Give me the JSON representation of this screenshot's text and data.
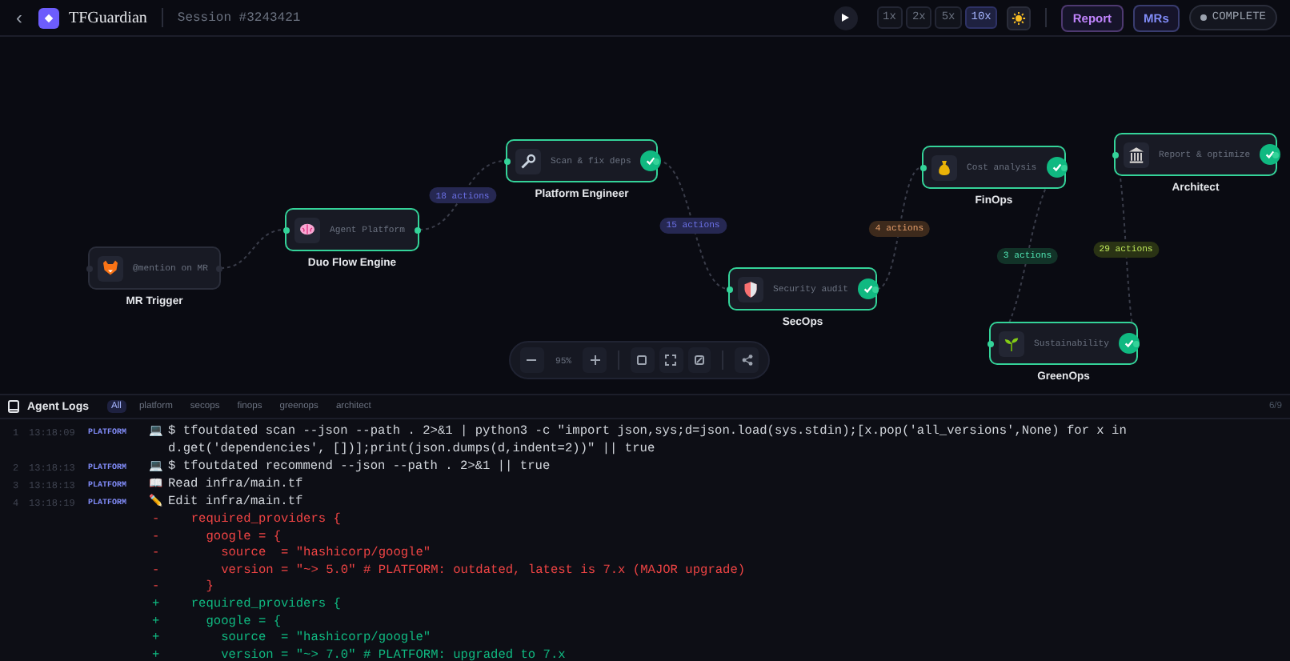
{
  "topbar": {
    "back": "‹",
    "app_name": "TFGuardian",
    "session": "Session #3243421",
    "speeds": [
      {
        "label": "1x",
        "selected": false
      },
      {
        "label": "2x",
        "selected": false
      },
      {
        "label": "5x",
        "selected": false
      },
      {
        "label": "10x",
        "selected": true
      }
    ],
    "buttons": [
      {
        "label": "Report",
        "color": "#c084fc"
      },
      {
        "label": "MRs",
        "color": "#818cf8"
      }
    ],
    "status": "COMPLETE"
  },
  "flow": {
    "nodes": [
      {
        "label": "@mention on MR",
        "name": "MR Trigger",
        "active": false,
        "completed": false
      },
      {
        "label": "Agent Platform",
        "name": "Duo Flow Engine",
        "active": true,
        "completed": false
      },
      {
        "label": "Scan & fix deps",
        "name": "Platform Engineer",
        "active": true,
        "completed": true
      },
      {
        "label": "Security audit",
        "name": "SecOps",
        "active": true,
        "completed": true
      },
      {
        "label": "Cost analysis",
        "name": "FinOps",
        "active": true,
        "completed": true
      },
      {
        "label": "Report & optimize",
        "name": "Architect",
        "active": true,
        "completed": true
      },
      {
        "label": "Sustainability",
        "name": "GreenOps",
        "active": true,
        "completed": true
      }
    ],
    "edge_labels": [
      {
        "label": "18 actions",
        "color": "#262852"
      },
      {
        "label": "15 actions",
        "color": "#262852"
      },
      {
        "label": "4 actions",
        "color": "#3d2a1c"
      },
      {
        "label": "3 actions",
        "color": "#123328"
      },
      {
        "label": "29 actions",
        "color": "#2a3314"
      }
    ],
    "zoom": "95%"
  },
  "logs": {
    "title": "Agent Logs",
    "filters": [
      {
        "label": "All",
        "selected": true
      },
      {
        "label": "platform",
        "selected": false
      },
      {
        "label": "secops",
        "selected": false
      },
      {
        "label": "finops",
        "selected": false
      },
      {
        "label": "greenops",
        "selected": false
      },
      {
        "label": "architect",
        "selected": false
      }
    ],
    "count": "6/9",
    "entries": [
      {
        "number": "1",
        "time": "13:18:09",
        "agent": "PLATFORM",
        "icon": "💻",
        "text": "$ tfoutdated scan --json --path . 2>&1 | python3 -c \"import json,sys;d=json.load(sys.stdin);[x.pop('all_versions',None) for x in d.get('dependencies', [])];print(json.dumps(d,indent=2))\" || true"
      },
      {
        "number": "2",
        "time": "13:18:13",
        "agent": "PLATFORM",
        "icon": "💻",
        "text": "$ tfoutdated recommend --json --path . 2>&1 || true"
      },
      {
        "number": "3",
        "time": "13:18:13",
        "agent": "PLATFORM",
        "icon": "📖",
        "text": "Read infra/main.tf"
      },
      {
        "number": "4",
        "time": "13:18:19",
        "agent": "PLATFORM",
        "icon": "✏️",
        "text": "Edit infra/main.tf",
        "diff": [
          {
            "kind": "removed",
            "sign": "-",
            "text": "  required_providers {"
          },
          {
            "kind": "removed",
            "sign": "-",
            "text": "    google = {"
          },
          {
            "kind": "removed",
            "sign": "-",
            "text": "      source  = \"hashicorp/google\""
          },
          {
            "kind": "removed",
            "sign": "-",
            "text": "      version = \"~> 5.0\" # PLATFORM: outdated, latest is 7.x (MAJOR upgrade)"
          },
          {
            "kind": "removed",
            "sign": "-",
            "text": "    }"
          },
          {
            "kind": "added",
            "sign": "+",
            "text": "  required_providers {"
          },
          {
            "kind": "added",
            "sign": "+",
            "text": "    google = {"
          },
          {
            "kind": "added",
            "sign": "+",
            "text": "      source  = \"hashicorp/google\""
          },
          {
            "kind": "added",
            "sign": "+",
            "text": "      version = \"~> 7.0\" # PLATFORM: upgraded to 7.x"
          }
        ]
      }
    ]
  }
}
